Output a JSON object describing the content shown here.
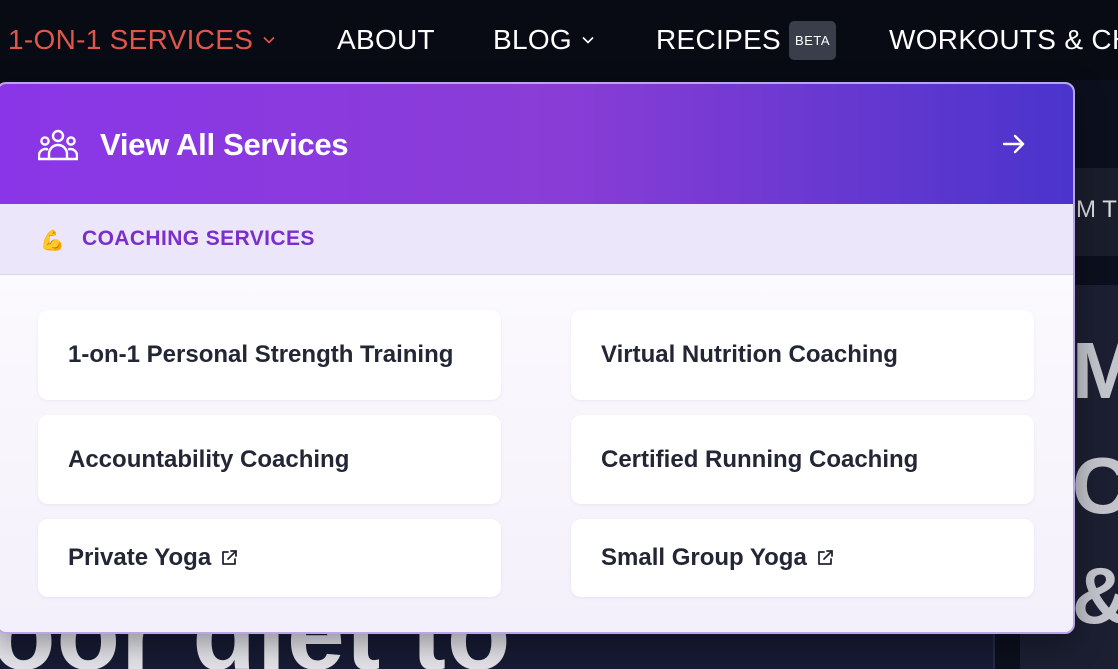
{
  "nav": {
    "items": [
      {
        "label": "1-ON-1 SERVICES",
        "active": true,
        "has_chevron": true
      },
      {
        "label": "ABOUT",
        "active": false,
        "has_chevron": false
      },
      {
        "label": "BLOG",
        "active": false,
        "has_chevron": true
      },
      {
        "label": "RECIPES",
        "active": false,
        "has_chevron": false,
        "badge": "BETA"
      },
      {
        "label": "WORKOUTS & CH",
        "active": false,
        "has_chevron": false
      }
    ]
  },
  "background": {
    "band_text": "M T",
    "side_letters": [
      "M",
      "C",
      "&"
    ],
    "hero_text": "oor diet to"
  },
  "dropdown": {
    "header": {
      "title": "View All Services",
      "icon": "users-group-icon",
      "arrow_icon": "arrow-right-icon"
    },
    "section": {
      "emoji": "💪",
      "label": "COACHING SERVICES"
    },
    "services": [
      {
        "label": "1-on-1 Personal Strength Training",
        "external": false
      },
      {
        "label": "Virtual Nutrition Coaching",
        "external": false
      },
      {
        "label": "Accountability Coaching",
        "external": false
      },
      {
        "label": "Certified Running Coaching",
        "external": false
      },
      {
        "label": "Private Yoga",
        "external": true
      },
      {
        "label": "Small Group Yoga",
        "external": true
      }
    ]
  },
  "colors": {
    "nav_bg": "#080a14",
    "active_nav": "#e0574a",
    "header_gradient_start": "#8a36e8",
    "header_gradient_end": "#4a34cc",
    "section_label": "#7b2fc8",
    "dropdown_border": "#b9a6e6"
  }
}
